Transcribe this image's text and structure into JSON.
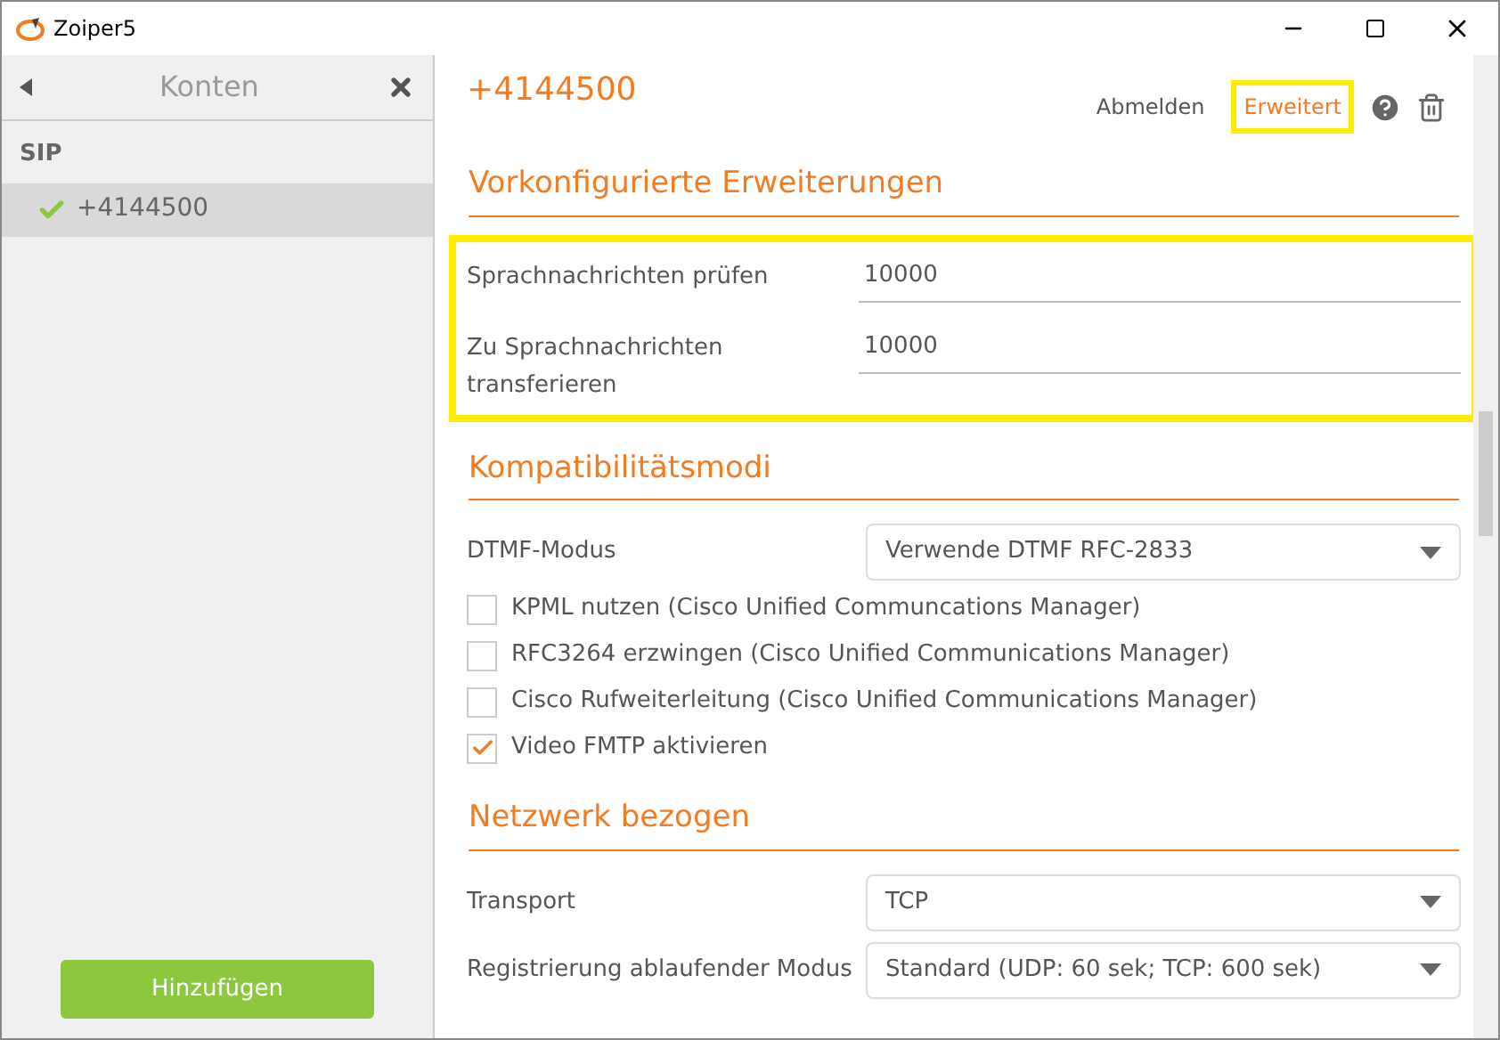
{
  "window": {
    "title": "Zoiper5"
  },
  "sidebar": {
    "title": "Konten",
    "group": "SIP",
    "accounts": [
      {
        "name": "+4144500",
        "selected": true,
        "registered": true
      }
    ],
    "add_button": "Hinzufügen"
  },
  "header": {
    "title": "+4144500",
    "actions": [
      {
        "label": "Abmelden",
        "selected": false,
        "highlighted": false
      },
      {
        "label": "Erweitert",
        "selected": true,
        "highlighted": true
      }
    ]
  },
  "sections": [
    {
      "title": "Vorkonfigurierte Erweiterungen",
      "highlighted": true,
      "rows": [
        {
          "kind": "text",
          "label": "Sprachnachrichten prüfen",
          "value": "10000"
        },
        {
          "kind": "text",
          "label": "Zu Sprachnachrichten transferieren",
          "value": "10000"
        }
      ]
    },
    {
      "title": "Kompatibilitätsmodi",
      "highlighted": false,
      "rows": [
        {
          "kind": "select",
          "label": "DTMF-Modus",
          "value": "Verwende DTMF RFC-2833"
        },
        {
          "kind": "checkbox",
          "label": "KPML nutzen (Cisco Unified Communcations Manager)",
          "checked": false
        },
        {
          "kind": "checkbox",
          "label": "RFC3264 erzwingen (Cisco Unified Communications Manager)",
          "checked": false
        },
        {
          "kind": "checkbox",
          "label": "Cisco Rufweiterleitung (Cisco Unified Communications Manager)",
          "checked": false
        },
        {
          "kind": "checkbox",
          "label": "Video FMTP aktivieren",
          "checked": true
        }
      ]
    },
    {
      "title": "Netzwerk bezogen",
      "highlighted": false,
      "rows": [
        {
          "kind": "select",
          "label": "Transport",
          "value": "TCP"
        },
        {
          "kind": "select",
          "label": "Registrierung ablaufender Modus",
          "value": "Standard (UDP: 60 sek; TCP: 600 sek)"
        }
      ]
    }
  ]
}
